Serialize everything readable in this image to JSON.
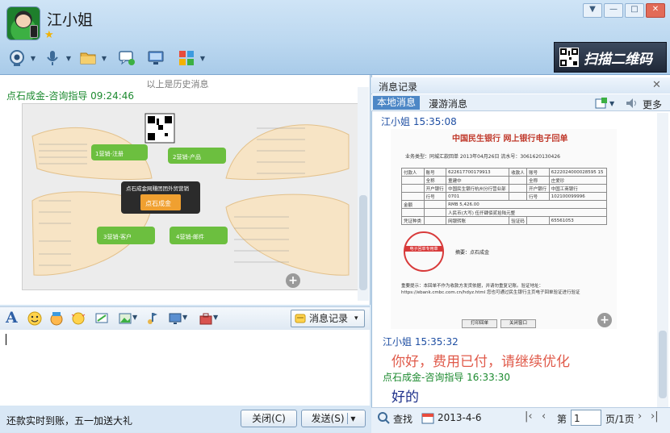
{
  "window": {
    "contact_name": "江小姐",
    "controls": [
      "▼",
      "—",
      "□",
      "✕"
    ]
  },
  "banner": {
    "scan_label": "扫描二维码"
  },
  "chat": {
    "history_divider": "以上是历史消息",
    "messages": [
      {
        "sender": "点石成金-咨询指导",
        "time": "09:24:46"
      }
    ],
    "mindmap": {
      "center_title": "点石成金网赚团团外贸营销",
      "logo_text": "点石成金",
      "branches": [
        "1营销-注册",
        "2营销-产品",
        "3营销-客户",
        "4营销-邮件"
      ]
    }
  },
  "input_toolbar": {
    "msg_record_label": "消息记录"
  },
  "bottom": {
    "ad_text": "还款实时到账，五一加送大礼",
    "close_label": "关闭(C)",
    "send_label": "发送(S)",
    "send_dropdown": "▾"
  },
  "record": {
    "title": "消息记录",
    "tabs": {
      "local": "本地消息",
      "roam": "漫游消息"
    },
    "more_label": "更多",
    "entries": [
      {
        "sender": "江小姐",
        "time": "15:35:08"
      },
      {
        "sender": "江小姐",
        "time": "15:35:32",
        "text": "你好，费用已付，请继续优化"
      },
      {
        "sender": "点石成金-咨询指导",
        "time": "16:33:30",
        "text": "好的"
      }
    ],
    "receipt": {
      "bank_head": "中国民生银行  网上银行电子回单",
      "meta": "业务类型：同城汇款回单   2013年04月26日   流水号：3061620130426",
      "rows": [
        [
          "付款人",
          "账号",
          "622617700179913",
          "收款人",
          "账号",
          "6222024000028595 15"
        ],
        [
          "",
          "全称",
          "童建中",
          "",
          "全称",
          "庄爱珍"
        ],
        [
          "",
          "开户银行",
          "中国民生银行杭州分行营业部",
          "",
          "开户银行",
          "中国工商银行"
        ],
        [
          "",
          "行号",
          "0701",
          "",
          "行号",
          "102100099996"
        ],
        [
          "金额",
          "",
          "RMB 5,426.00",
          "",
          "",
          ""
        ],
        [
          "",
          "",
          "人民币(大写) 伍仟肆佰贰拾陆元整",
          "",
          "",
          ""
        ],
        [
          "凭证种类",
          "",
          "网银转账",
          "验证码",
          "",
          "65561053"
        ]
      ],
      "seal_text": "电子回单专用章",
      "memo": "摘要：点石成金",
      "notice": "重要提示：本回单不作为收款方发货依据，并请勿重复记账。验证地址：https://ebank.cmbc.com.cn/hdyz.html 您也可通过民生银行主页电子回单验证进行验证",
      "print_btn": "打印回单",
      "close_btn": "关闭窗口"
    },
    "bottom": {
      "search_label": "查找",
      "date": "2013-4-6",
      "page_prefix": "第",
      "page_value": "1",
      "page_suffix": "页/1页"
    }
  }
}
